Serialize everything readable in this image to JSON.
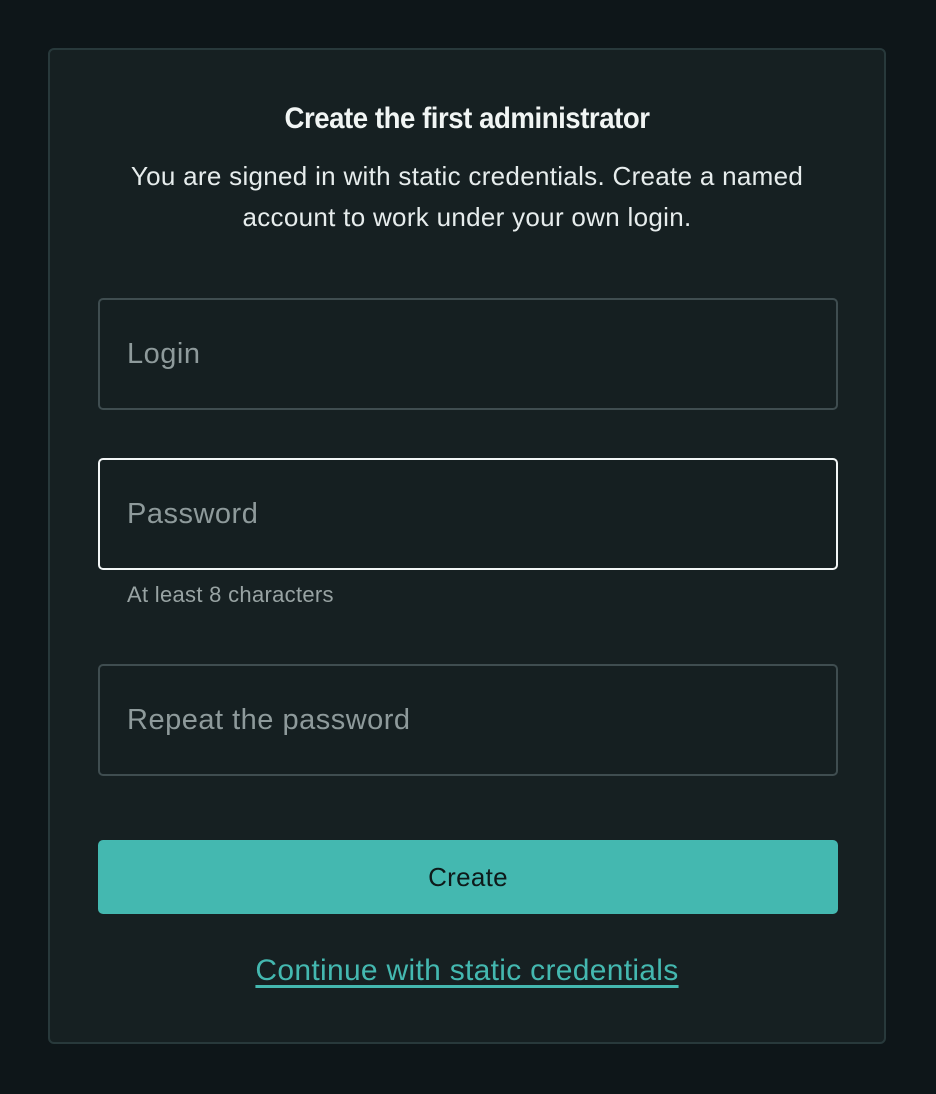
{
  "form": {
    "title": "Create the first administrator",
    "subtitle": "You are signed in with static credentials. Create a named account to work under your own login.",
    "login": {
      "placeholder": "Login",
      "value": ""
    },
    "password": {
      "placeholder": "Password",
      "value": "",
      "helper": "At least 8 characters"
    },
    "repeat_password": {
      "placeholder": "Repeat the password",
      "value": ""
    },
    "create_label": "Create",
    "static_link_label": "Continue with static credentials"
  },
  "colors": {
    "background": "#0e1619",
    "card": "#162022",
    "accent": "#44b8b0"
  }
}
